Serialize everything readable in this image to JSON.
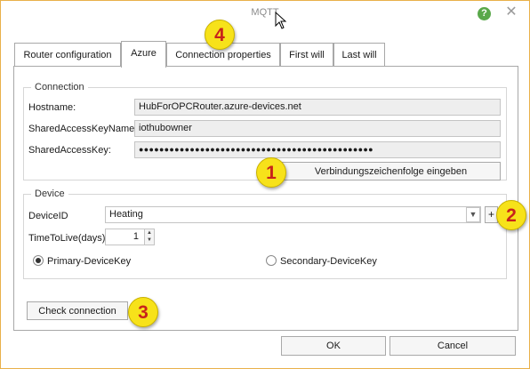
{
  "window": {
    "title": "MQTT",
    "help_icon": "question-icon",
    "help_glyph": "?",
    "close_glyph": "✕",
    "accent_color": "#e9b14a"
  },
  "tabs": [
    {
      "label": "Router configuration"
    },
    {
      "label": "Azure"
    },
    {
      "label": "Connection properties"
    },
    {
      "label": "First will"
    },
    {
      "label": "Last will"
    }
  ],
  "connection": {
    "legend": "Connection",
    "hostname_label": "Hostname:",
    "hostname_value": "HubForOPCRouter.azure-devices.net",
    "keyname_label": "SharedAccessKeyName:",
    "keyname_value": "iothubowner",
    "key_label": "SharedAccessKey:",
    "key_value": "●●●●●●●●●●●●●●●●●●●●●●●●●●●●●●●●●●●●●●●●●●●●●●",
    "connection_string_button": "Verbindungszeichenfolge  eingeben"
  },
  "device": {
    "legend": "Device",
    "deviceid_label": "DeviceID",
    "deviceid_value": "Heating",
    "add_button": "+",
    "ttl_label": "TimeToLive(days)",
    "ttl_value": "1",
    "primary_label": "Primary-DeviceKey",
    "secondary_label": "Secondary-DeviceKey",
    "selected_key": "Primary-DeviceKey"
  },
  "check_button": "Check connection",
  "footer": {
    "ok_label": "OK",
    "cancel_label": "Cancel"
  },
  "annotations": [
    "1",
    "2",
    "3",
    "4"
  ]
}
